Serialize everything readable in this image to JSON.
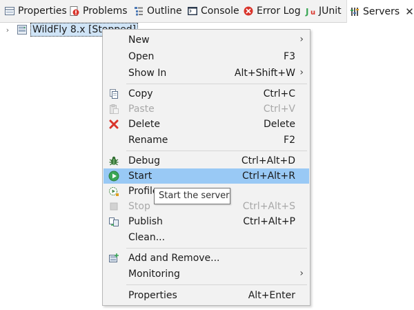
{
  "tabs": [
    {
      "label": "Properties",
      "icon": "properties-icon"
    },
    {
      "label": "Problems",
      "icon": "problems-icon"
    },
    {
      "label": "Outline",
      "icon": "outline-icon"
    },
    {
      "label": "Console",
      "icon": "console-icon"
    },
    {
      "label": "Error Log",
      "icon": "error-log-icon"
    },
    {
      "label": "JUnit",
      "icon": "junit-icon"
    },
    {
      "label": "Servers",
      "icon": "servers-icon",
      "active": true,
      "close": "✕"
    }
  ],
  "tree": {
    "expander": "›",
    "server_label": "WildFly 8.x  [Stopped]",
    "server_icon": "server-icon"
  },
  "menu": {
    "items": [
      {
        "label": "New",
        "accel": "",
        "submenu": true
      },
      {
        "label": "Open",
        "accel": "F3"
      },
      {
        "label": "Show In",
        "accel": "Alt+Shift+W",
        "submenu": true
      },
      {
        "label": "Copy",
        "accel": "Ctrl+C",
        "icon": "copy-icon"
      },
      {
        "label": "Paste",
        "accel": "Ctrl+V",
        "icon": "paste-icon",
        "disabled": true
      },
      {
        "label": "Delete",
        "accel": "Delete",
        "icon": "delete-icon"
      },
      {
        "label": "Rename",
        "accel": "F2"
      },
      {
        "label": "Debug",
        "accel": "Ctrl+Alt+D",
        "icon": "debug-icon"
      },
      {
        "label": "Start",
        "accel": "Ctrl+Alt+R",
        "icon": "start-icon",
        "highlighted": true
      },
      {
        "label": "Profile",
        "accel": "",
        "icon": "profile-icon"
      },
      {
        "label": "Stop",
        "accel": "Ctrl+Alt+S",
        "icon": "stop-icon",
        "disabled": true
      },
      {
        "label": "Publish",
        "accel": "Ctrl+Alt+P",
        "icon": "publish-icon"
      },
      {
        "label": "Clean...",
        "accel": ""
      },
      {
        "label": "Add and Remove...",
        "accel": "",
        "icon": "add-remove-icon"
      },
      {
        "label": "Monitoring",
        "accel": "",
        "submenu": true
      },
      {
        "label": "Properties",
        "accel": "Alt+Enter"
      }
    ],
    "submenu_arrow": "›"
  },
  "tooltip": {
    "text": "Start the server"
  },
  "colors": {
    "highlight": "#99c9f5",
    "menu_bg": "#f2f2f2",
    "selection": "#cfe4f7",
    "delete_red": "#d9342b",
    "start_green": "#3aa655"
  }
}
